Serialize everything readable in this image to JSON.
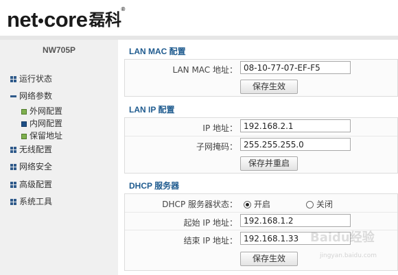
{
  "brand": {
    "name": "net",
    "name2": "core",
    "cn": "磊科",
    "reg": "®"
  },
  "sidebar": {
    "model": "NW705P",
    "items": [
      {
        "label": "运行状态",
        "expanded": false
      },
      {
        "label": "网络参数",
        "expanded": true
      },
      {
        "label": "无线配置",
        "expanded": false
      },
      {
        "label": "网络安全",
        "expanded": false
      },
      {
        "label": "高级配置",
        "expanded": false
      },
      {
        "label": "系统工具",
        "expanded": false
      }
    ],
    "subitems": [
      {
        "label": "外网配置"
      },
      {
        "label": "内网配置"
      },
      {
        "label": "保留地址"
      }
    ]
  },
  "lan_mac": {
    "title": "LAN MAC 配置",
    "mac_label": "LAN MAC 地址：",
    "mac_value": "08-10-77-07-EF-F5",
    "save_label": "保存生效"
  },
  "lan_ip": {
    "title": "LAN IP 配置",
    "ip_label": "IP 地址：",
    "ip_value": "192.168.2.1",
    "mask_label": "子网掩码：",
    "mask_value": "255.255.255.0",
    "save_label": "保存并重启"
  },
  "dhcp": {
    "title": "DHCP 服务器",
    "status_label": "DHCP 服务器状态：",
    "on_label": "开启",
    "off_label": "关闭",
    "enabled": true,
    "start_label": "起始 IP 地址：",
    "start_value": "192.168.1.2",
    "end_label": "结束 IP 地址：",
    "end_value": "192.168.1.33",
    "save_label": "保存生效"
  },
  "watermark": {
    "text": "Baidu经验",
    "sub": "jingyan.baidu.com"
  }
}
